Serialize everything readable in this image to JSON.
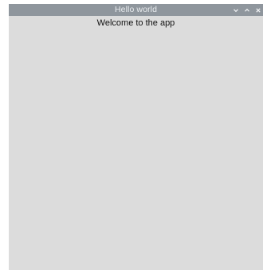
{
  "window": {
    "title": "Hello world",
    "controls": [
      "minimize-icon",
      "maximize-icon",
      "close-icon"
    ],
    "colors": {
      "titlebar": "#8f969d",
      "title_text": "#e9ecef",
      "body": "#dcdcdc"
    }
  },
  "content": {
    "welcome_text": "Welcome to the app"
  }
}
